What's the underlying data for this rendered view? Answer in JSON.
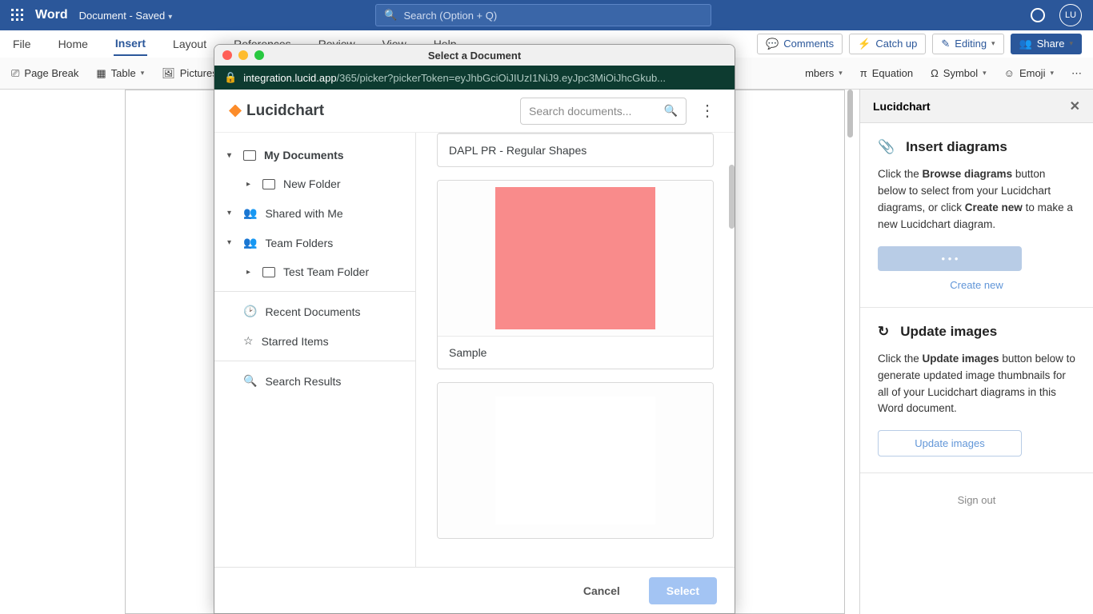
{
  "titlebar": {
    "app": "Word",
    "doc": "Document",
    "saved": "Saved",
    "search_ph": "Search (Option + Q)",
    "avatar": "LU"
  },
  "tabs": {
    "file": "File",
    "home": "Home",
    "insert": "Insert",
    "layout": "Layout",
    "references": "References",
    "review": "Review",
    "view": "View",
    "help": "Help"
  },
  "tabs_right": {
    "comments": "Comments",
    "catchup": "Catch up",
    "editing": "Editing",
    "share": "Share"
  },
  "ribbon": {
    "page_break": "Page Break",
    "table": "Table",
    "pictures": "Pictures",
    "numbers": "mbers",
    "equation": "Equation",
    "symbol": "Symbol",
    "emoji": "Emoji"
  },
  "picker": {
    "title": "Select a Document",
    "url_host": "integration.lucid.app",
    "url_path": "/365/picker?pickerToken=eyJhbGciOiJIUzI1NiJ9.eyJpc3MiOiJhcGkub...",
    "brand": "Lucidchart",
    "search_ph": "Search documents...",
    "sidebar": {
      "mydocs": "My Documents",
      "newfolder": "New Folder",
      "shared": "Shared with Me",
      "team": "Team Folders",
      "testteam": "Test Team Folder",
      "recent": "Recent Documents",
      "starred": "Starred Items",
      "results": "Search Results"
    },
    "docs": {
      "d1": "DAPL PR - Regular Shapes",
      "d2": "Sample"
    },
    "footer": {
      "cancel": "Cancel",
      "select": "Select"
    }
  },
  "panel": {
    "title": "Lucidchart",
    "sec1": {
      "heading": "Insert diagrams",
      "text_pre": "Click the ",
      "b1": "Browse diagrams",
      "text_mid": " button below to select from your Lucidchart diagrams, or click ",
      "b2": "Create new",
      "text_post": " to make a new Lucidchart diagram.",
      "btn_loading": "• • •",
      "create": "Create new"
    },
    "sec2": {
      "heading": "Update images",
      "text_pre": "Click the ",
      "b1": "Update images",
      "text_post": " button below to generate updated image thumbnails for all of your Lucidchart diagrams in this Word document.",
      "btn": "Update images"
    },
    "signout": "Sign out"
  }
}
